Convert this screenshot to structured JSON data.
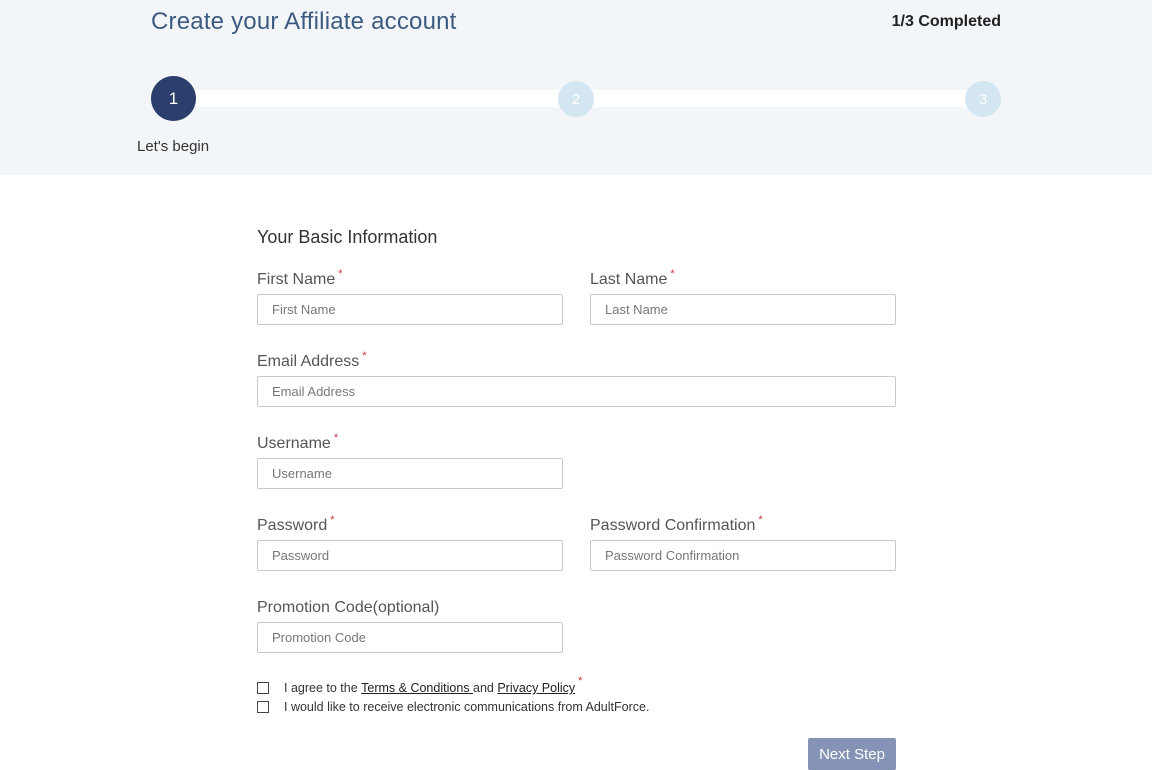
{
  "header": {
    "title": "Create your Affiliate account",
    "progress_text": "1/3 Completed",
    "steps": [
      {
        "label": "1",
        "state": "active"
      },
      {
        "label": "2",
        "state": "inactive"
      },
      {
        "label": "3",
        "state": "inactive"
      }
    ],
    "step_caption": "Let's begin"
  },
  "form": {
    "section_title": "Your Basic Information",
    "required_marker": "*",
    "fields": {
      "first_name": {
        "label": "First Name",
        "placeholder": "First Name",
        "value": ""
      },
      "last_name": {
        "label": "Last Name",
        "placeholder": "Last Name",
        "value": ""
      },
      "email": {
        "label": "Email Address",
        "placeholder": "Email Address",
        "value": ""
      },
      "username": {
        "label": "Username",
        "placeholder": "Username",
        "value": ""
      },
      "password": {
        "label": "Password",
        "placeholder": "Password",
        "value": ""
      },
      "password_confirmation": {
        "label": "Password Confirmation",
        "placeholder": "Password Confirmation",
        "value": ""
      },
      "promotion_code": {
        "label": "Promotion Code(optional)",
        "placeholder": "Promotion Code",
        "value": ""
      }
    },
    "agree_terms": {
      "checked": false,
      "prefix": "I agree to the ",
      "terms_link": "Terms & Conditions ",
      "middle": "and ",
      "privacy_link": "Privacy Policy"
    },
    "electronic_comms": {
      "checked": false,
      "label": "I would like to receive electronic communications from AdultForce."
    },
    "next_button": "Next Step"
  },
  "colors": {
    "header_bg": "#f3f6f9",
    "title_color": "#3d5a80",
    "active_step": "#2c3e6b",
    "inactive_step": "#d5e6f3",
    "required": "#d0343a",
    "next_button_bg": "#8593b6"
  }
}
